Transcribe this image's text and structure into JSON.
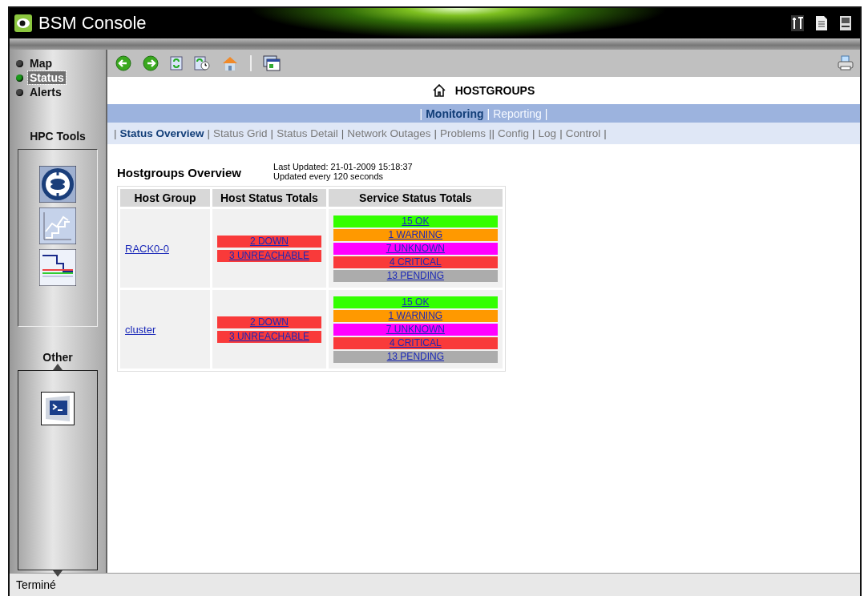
{
  "window": {
    "title": "BSM Console"
  },
  "sidebar": {
    "items": [
      {
        "label": "Map",
        "selected": false
      },
      {
        "label": "Status",
        "selected": true
      },
      {
        "label": "Alerts",
        "selected": false
      }
    ],
    "sections": [
      {
        "title": "HPC Tools",
        "kind": "tools"
      },
      {
        "title": "Other",
        "kind": "scroller"
      }
    ]
  },
  "page": {
    "title": "HOSTGROUPS",
    "primary_nav": [
      {
        "kind": "separator",
        "text": "|"
      },
      {
        "kind": "tab",
        "label": "Monitoring",
        "selected": true
      },
      {
        "kind": "separator",
        "text": "|"
      },
      {
        "kind": "tab",
        "label": "Reporting",
        "selected": false
      },
      {
        "kind": "separator",
        "text": "|"
      }
    ],
    "secondary_nav": [
      {
        "kind": "separator",
        "text": "|"
      },
      {
        "kind": "tab",
        "label": "Status Overview",
        "selected": true
      },
      {
        "kind": "separator",
        "text": "|"
      },
      {
        "kind": "tab",
        "label": "Status Grid",
        "selected": false
      },
      {
        "kind": "separator",
        "text": "|"
      },
      {
        "kind": "tab",
        "label": "Status Detail",
        "selected": false
      },
      {
        "kind": "separator",
        "text": "|"
      },
      {
        "kind": "tab",
        "label": "Network Outages",
        "selected": false
      },
      {
        "kind": "separator",
        "text": "|"
      },
      {
        "kind": "tab",
        "label": "Problems",
        "selected": false
      },
      {
        "kind": "separator",
        "text": "||"
      },
      {
        "kind": "tab",
        "label": "Config",
        "selected": false
      },
      {
        "kind": "separator",
        "text": "|"
      },
      {
        "kind": "tab",
        "label": "Log",
        "selected": false
      },
      {
        "kind": "separator",
        "text": "|"
      },
      {
        "kind": "tab",
        "label": "Control",
        "selected": false
      },
      {
        "kind": "separator",
        "text": "|"
      }
    ],
    "heading": "Hostgroups Overview",
    "last_updated": "Last Updated: 21-01-2009 15:18:37",
    "update_interval": "Updated every 120 seconds"
  },
  "table": {
    "columns": [
      "Host Group",
      "Host Status Totals",
      "Service Status Totals"
    ],
    "rows": [
      {
        "group": "RACK0-0",
        "host_status": [
          {
            "label": "2 DOWN",
            "color": "#f93a3a"
          },
          {
            "label": "3 UNREACHABLE",
            "color": "#f93a3a"
          }
        ],
        "service_status": [
          {
            "label": "15 OK",
            "color": "#33ff00"
          },
          {
            "label": "1 WARNING",
            "color": "#ff9900"
          },
          {
            "label": "7 UNKNOWN",
            "color": "#ff00ff"
          },
          {
            "label": "4 CRITICAL",
            "color": "#f93a3a"
          },
          {
            "label": "13 PENDING",
            "color": "#acacac"
          }
        ]
      },
      {
        "group": "cluster",
        "host_status": [
          {
            "label": "2 DOWN",
            "color": "#f93a3a"
          },
          {
            "label": "3 UNREACHABLE",
            "color": "#f93a3a"
          }
        ],
        "service_status": [
          {
            "label": "15 OK",
            "color": "#33ff00"
          },
          {
            "label": "1 WARNING",
            "color": "#ff9900"
          },
          {
            "label": "7 UNKNOWN",
            "color": "#ff00ff"
          },
          {
            "label": "4 CRITICAL",
            "color": "#f93a3a"
          },
          {
            "label": "13 PENDING",
            "color": "#acacac"
          }
        ]
      }
    ]
  },
  "status_bar": {
    "text": "Terminé"
  }
}
